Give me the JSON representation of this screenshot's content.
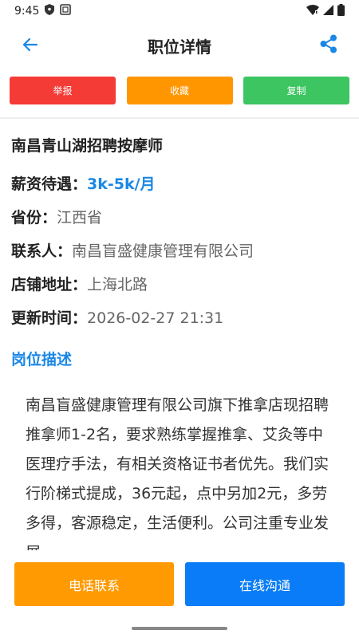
{
  "status_bar": {
    "time": "9:45"
  },
  "header": {
    "title": "职位详情"
  },
  "actions": {
    "report_label": "举报",
    "favorite_label": "收藏",
    "copy_label": "复制"
  },
  "job": {
    "title": "南昌青山湖招聘按摩师",
    "salary_label": "薪资待遇：",
    "salary_value": "3k-5k/月",
    "province_label": "省份：",
    "province_value": "江西省",
    "contact_label": "联系人：",
    "contact_value": "南昌盲盛健康管理有限公司",
    "address_label": "店铺地址：",
    "address_value": "上海北路",
    "updated_label": "更新时间：",
    "updated_value": "2026-02-27 21:31"
  },
  "description": {
    "section_title": "岗位描述",
    "text": "南昌盲盛健康管理有限公司旗下推拿店现招聘推拿师1-2名，要求熟练掌握推拿、艾灸等中医理疗手法，有相关资格证书者优先。我们实行阶梯式提成，36元起，点中另加2元，多劳多得，客源稳定，生活便利。公司注重专业发展，"
  },
  "bottom": {
    "call_label": "电话联系",
    "chat_label": "在线沟通"
  },
  "colors": {
    "accent_blue": "#1a87e6",
    "report_red": "#f43b36",
    "favorite_orange": "#ff9600",
    "copy_green": "#3cc561",
    "call_orange": "#ff9a02",
    "chat_blue": "#0a7cf7"
  }
}
